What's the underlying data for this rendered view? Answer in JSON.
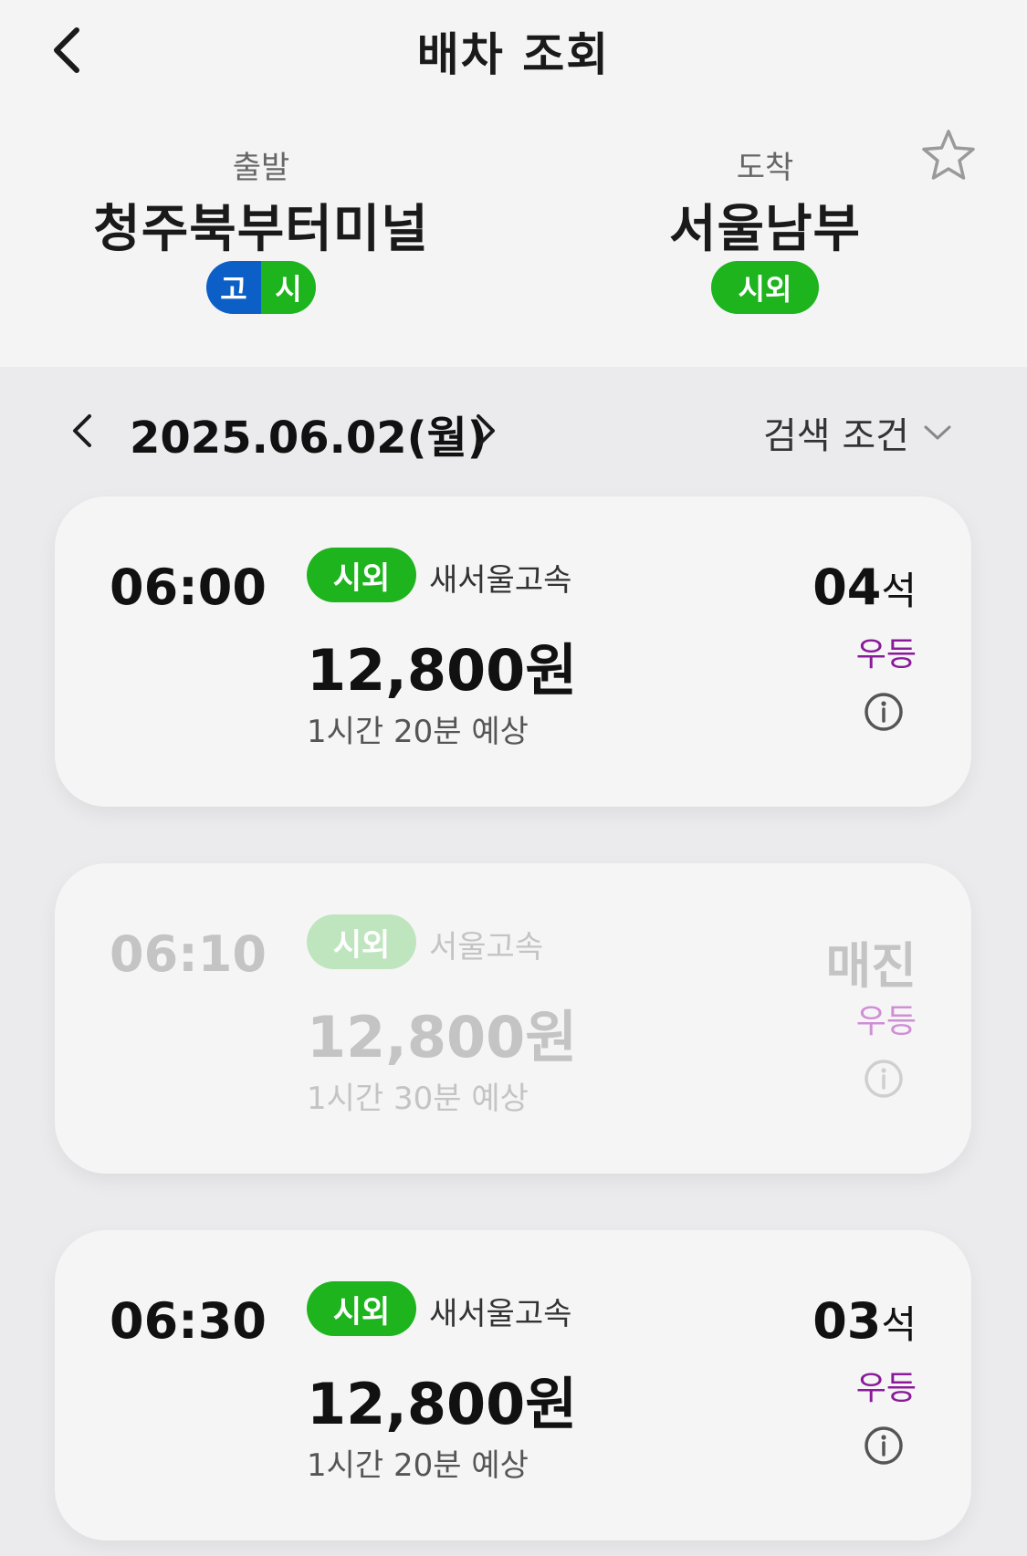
{
  "header": {
    "title": "배차 조회"
  },
  "route": {
    "departure": {
      "role": "출발",
      "name": "청주북부터미널",
      "badges": [
        "고",
        "시"
      ]
    },
    "arrival": {
      "role": "도착",
      "name": "서울남부",
      "badge": "시외"
    }
  },
  "datebar": {
    "date": "2025.06.02(월)",
    "filter_label": "검색 조건"
  },
  "schedules": [
    {
      "time": "06:00",
      "type": "시외",
      "company": "새서울고속",
      "price": "12,800원",
      "duration": "1시간 20분 예상",
      "seats": "04",
      "seat_unit": "석",
      "grade": "우등"
    },
    {
      "time": "06:10",
      "type": "시외",
      "company": "서울고속",
      "price": "12,800원",
      "duration": "1시간 30분 예상",
      "seats": "매진",
      "seat_unit": "",
      "grade": "우등"
    },
    {
      "time": "06:30",
      "type": "시외",
      "company": "새서울고속",
      "price": "12,800원",
      "duration": "1시간 20분 예상",
      "seats": "03",
      "seat_unit": "석",
      "grade": "우등"
    }
  ],
  "colors": {
    "express_blue": "#0b5fc7",
    "intercity_green": "#1db41d",
    "grade_purple": "#8a1a9a"
  }
}
